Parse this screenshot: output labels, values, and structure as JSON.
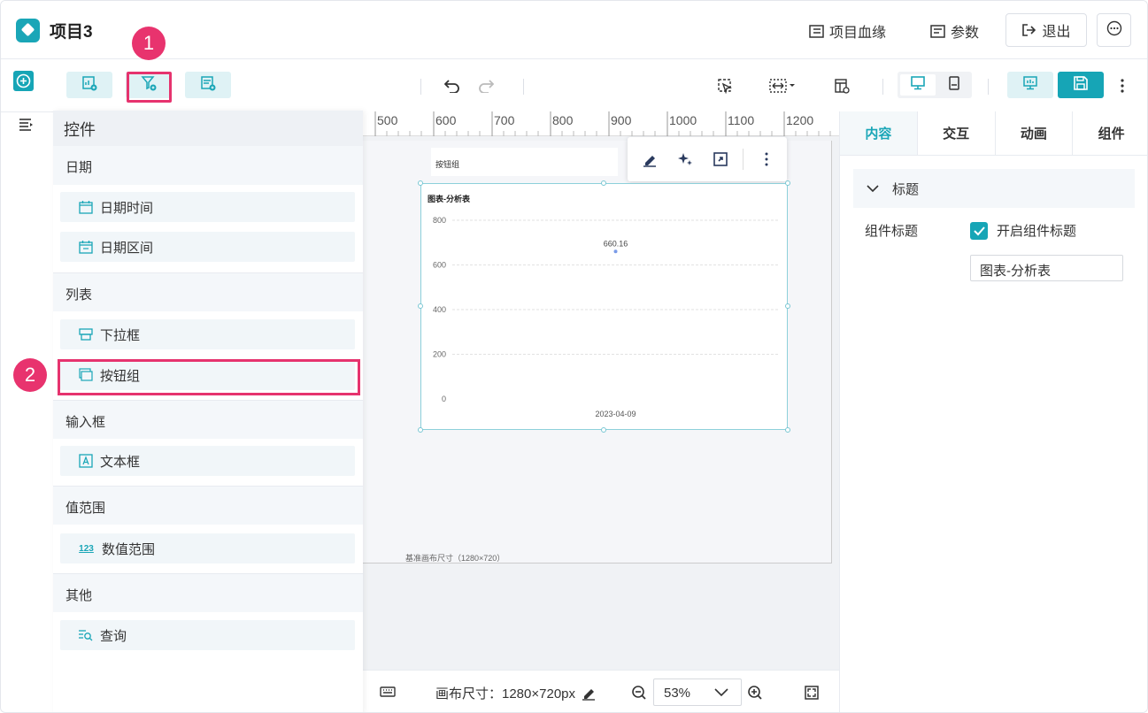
{
  "header": {
    "title": "项目3",
    "lineage_label": "项目血缘",
    "params_label": "参数",
    "exit_label": "退出"
  },
  "annotations": {
    "step1": "1",
    "step2": "2"
  },
  "controls_panel": {
    "title": "控件",
    "groups": [
      {
        "label": "日期",
        "items": [
          "日期时间",
          "日期区间"
        ]
      },
      {
        "label": "列表",
        "items": [
          "下拉框",
          "按钮组"
        ]
      },
      {
        "label": "输入框",
        "items": [
          "文本框"
        ]
      },
      {
        "label": "值范围",
        "items": [
          "数值范围"
        ]
      },
      {
        "label": "其他",
        "items": [
          "查询"
        ]
      }
    ]
  },
  "ruler": {
    "ticks": [
      "500",
      "600",
      "700",
      "800",
      "900",
      "1000",
      "1100",
      "1200"
    ]
  },
  "canvas": {
    "button_group_label": "按钮组",
    "base_size_label": "基准画布尺寸（1280×720）"
  },
  "chart_data": {
    "type": "scatter",
    "title": "图表-分析表",
    "categories": [
      "2023-04-09"
    ],
    "values": [
      660.16
    ],
    "data_labels": [
      "660.16"
    ],
    "y_ticks": [
      "800",
      "600",
      "400",
      "200",
      "0"
    ],
    "ylim": [
      0,
      800
    ],
    "grid": true,
    "accent_color": "#7a9be8"
  },
  "bottom": {
    "canvas_size_label": "画布尺寸：1280×720px",
    "zoom": "53%"
  },
  "right_panel": {
    "tabs": [
      "内容",
      "交互",
      "动画",
      "组件"
    ],
    "active_tab": "内容",
    "section_label": "标题",
    "component_title_label": "组件标题",
    "enable_title_label": "开启组件标题",
    "title_value": "图表-分析表"
  },
  "colors": {
    "accent": "#1aa6b7",
    "highlight": "#e6336e"
  }
}
